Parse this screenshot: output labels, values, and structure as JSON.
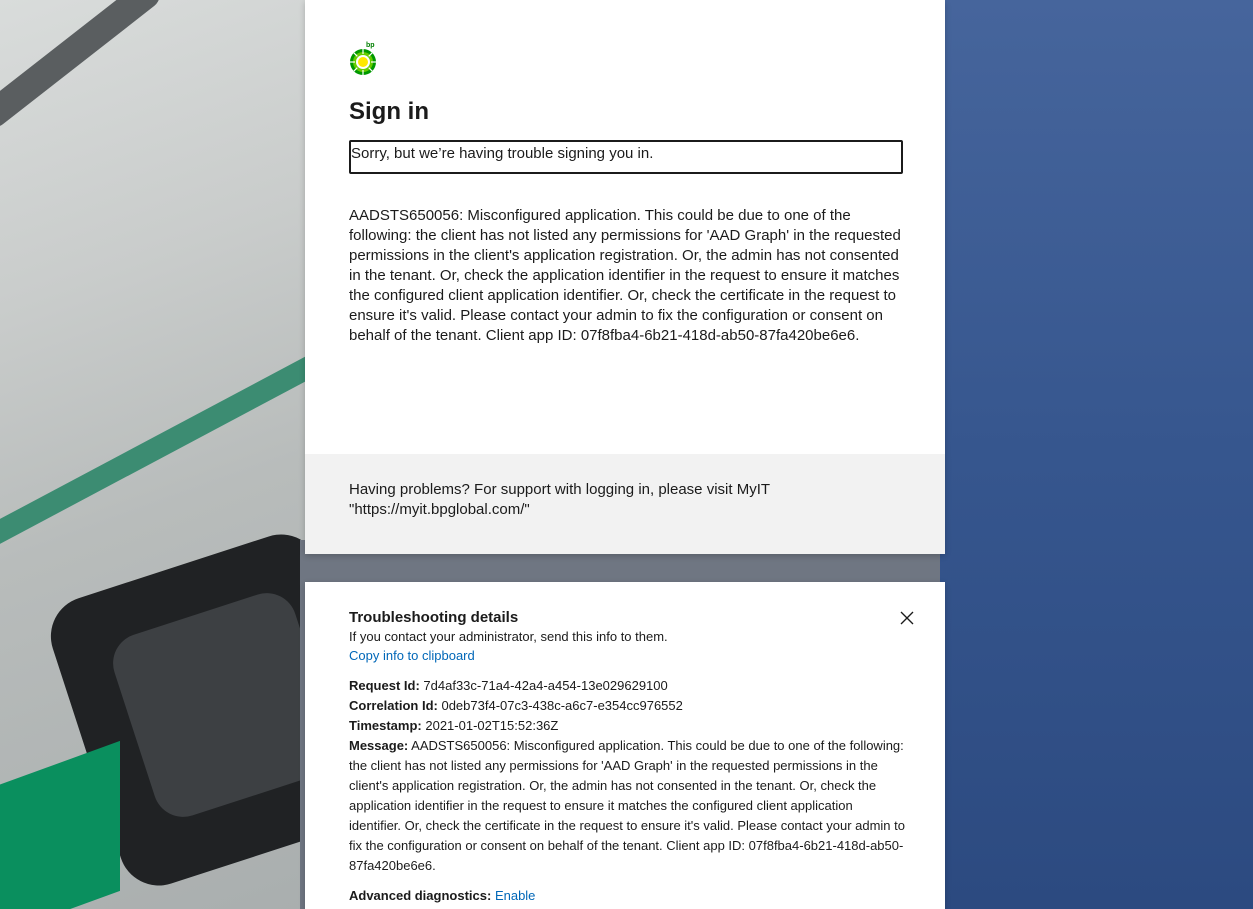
{
  "brand": {
    "logo_superscript": "bp",
    "logo_icon": "bp-helios-icon",
    "colors": {
      "green": "#009900",
      "yellow": "#ffe800",
      "link": "#0067b8"
    }
  },
  "signin": {
    "title": "Sign in",
    "error_summary": "Sorry, but we’re having trouble signing you in.",
    "error_description": "AADSTS650056: Misconfigured application. This could be due to one of the following: the client has not listed any permissions for 'AAD Graph' in the requested permissions in the client's application registration. Or, the admin has not consented in the tenant. Or, check the application identifier in the request to ensure it matches the configured client application identifier. Or, check the certificate in the request to ensure it's valid. Please contact your admin to fix the configuration or consent on behalf of the tenant. Client app ID: 07f8fba4-6b21-418d-ab50-87fa420be6e6."
  },
  "footer": {
    "line1": "Having problems? For support with logging in, please visit MyIT",
    "line2": "\"https://myit.bpglobal.com/\""
  },
  "troubleshooting": {
    "title": "Troubleshooting details",
    "subtitle": "If you contact your administrator, send this info to them.",
    "copy_link": "Copy info to clipboard",
    "close_icon": "close-icon",
    "request_id_label": "Request Id:",
    "request_id": "7d4af33c-71a4-42a4-a454-13e029629100",
    "correlation_id_label": "Correlation Id:",
    "correlation_id": "0deb73f4-07c3-438c-a6c7-e354cc976552",
    "timestamp_label": "Timestamp:",
    "timestamp": "2021-01-02T15:52:36Z",
    "message_label": "Message:",
    "message": "AADSTS650056: Misconfigured application. This could be due to one of the following: the client has not listed any permissions for 'AAD Graph' in the requested permissions in the client's application registration. Or, the admin has not consented in the tenant. Or, check the application identifier in the request to ensure it matches the configured client application identifier. Or, check the certificate in the request to ensure it's valid. Please contact your admin to fix the configuration or consent on behalf of the tenant. Client app ID: 07f8fba4-6b21-418d-ab50-87fa420be6e6.",
    "advanced_label": "Advanced diagnostics:",
    "advanced_link": "Enable"
  }
}
